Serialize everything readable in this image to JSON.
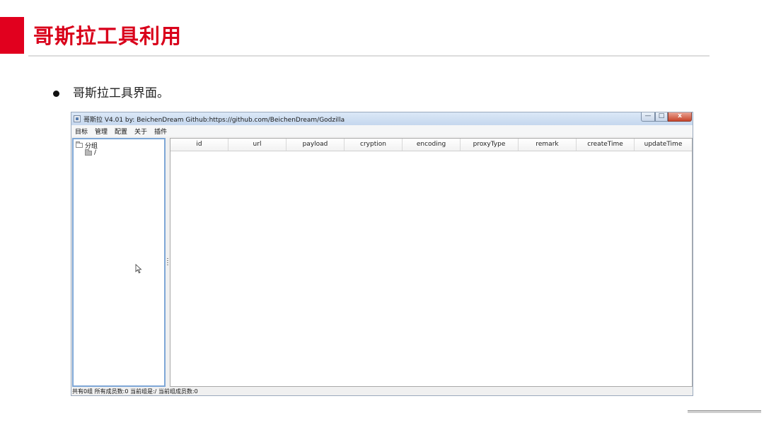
{
  "slide": {
    "title": "哥斯拉工具利用",
    "bullet": "哥斯拉工具界面。",
    "accent_color": "#e1001e",
    "title_color": "#d9001b"
  },
  "window": {
    "title": "哥斯拉   V4.01 by: BeichenDream Github:https://github.com/BeichenDream/Godzilla",
    "controls": {
      "minimize": "—",
      "maximize": "□",
      "close": "x"
    },
    "menu": [
      "目标",
      "管理",
      "配置",
      "关于",
      "插件"
    ],
    "tree": {
      "root_label": "分组",
      "child_label": "/"
    },
    "table": {
      "columns": [
        "id",
        "url",
        "payload",
        "cryption",
        "encoding",
        "proxyType",
        "remark",
        "createTime",
        "updateTime"
      ]
    },
    "status": "共有0组 所有成员数:0 当前组是:/ 当前组成员数:0"
  }
}
